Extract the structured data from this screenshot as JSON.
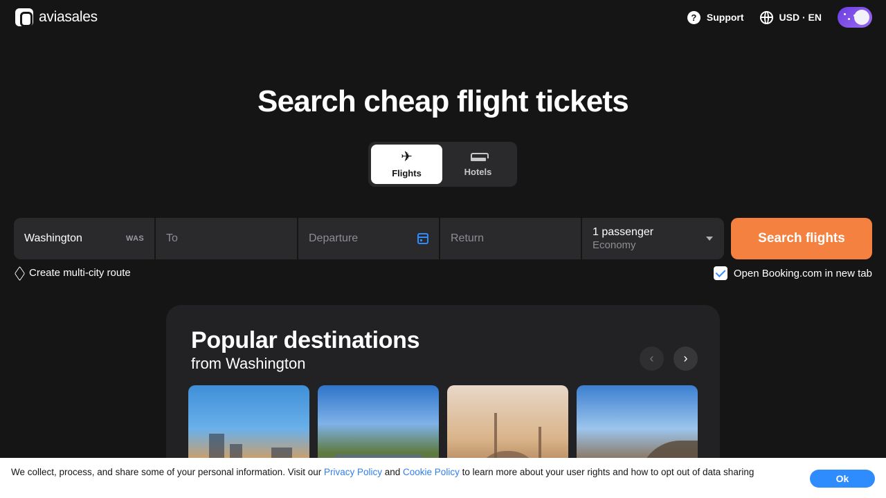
{
  "header": {
    "logo_text": "aviasales",
    "support_label": "Support",
    "locale_label": "USD · EN"
  },
  "hero": {
    "title": "Search cheap flight tickets",
    "tabs": [
      {
        "label": "Flights",
        "icon": "plane-icon",
        "active": true
      },
      {
        "label": "Hotels",
        "icon": "bed-icon",
        "active": false
      }
    ]
  },
  "search": {
    "origin_value": "Washington",
    "origin_code": "WAS",
    "destination_placeholder": "To",
    "departure_placeholder": "Departure",
    "return_placeholder": "Return",
    "passengers": "1 passenger",
    "cabin_class": "Economy",
    "search_button": "Search flights",
    "multi_city_label": "Create multi-city route",
    "booking_label": "Open Booking.com in new tab",
    "booking_checked": true
  },
  "popular": {
    "title": "Popular destinations",
    "subtitle": "from Washington",
    "prev_icon": "chevron-left-icon",
    "next_icon": "chevron-right-icon"
  },
  "cookie": {
    "text_before": "We collect, process, and share some of your personal information. Visit our ",
    "privacy_link": "Privacy Policy",
    "text_and": " and ",
    "cookie_link": "Cookie Policy",
    "text_after": " to learn more about your user rights and how to opt out of data sharing",
    "ok_button": "Ok"
  },
  "colors": {
    "background": "#151516",
    "accent_orange": "#f4813f",
    "accent_blue": "#2f8cff",
    "field_bg": "#2a2a2d"
  }
}
